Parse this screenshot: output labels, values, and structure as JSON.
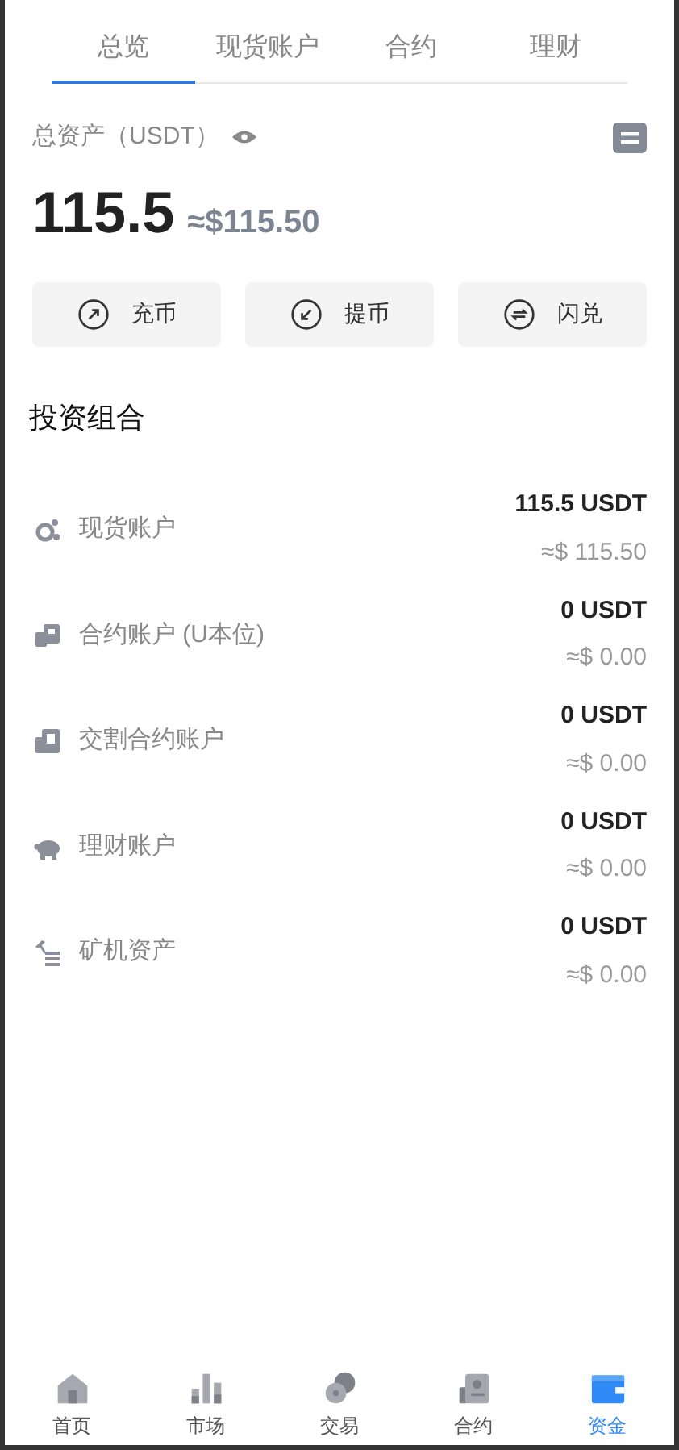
{
  "tabs": [
    {
      "label": "总览",
      "selected": true
    },
    {
      "label": "现货账户",
      "selected": false
    },
    {
      "label": "合约",
      "selected": false
    },
    {
      "label": "理财",
      "selected": false
    }
  ],
  "total": {
    "label": "总资产（USDT）",
    "amount": "115.5",
    "approx": "≈$115.50"
  },
  "actions": [
    {
      "kind": "deposit",
      "label": "充币"
    },
    {
      "kind": "withdraw",
      "label": "提币"
    },
    {
      "kind": "swap",
      "label": "闪兑"
    }
  ],
  "portfolio": {
    "title": "投资组合",
    "accounts": [
      {
        "kind": "spot",
        "name": "现货账户",
        "amount": "115.5 USDT",
        "approx": "≈$ 115.50"
      },
      {
        "kind": "futures",
        "name": "合约账户 (U本位)",
        "amount": "0 USDT",
        "approx": "≈$ 0.00"
      },
      {
        "kind": "delivery",
        "name": "交割合约账户",
        "amount": "0 USDT",
        "approx": "≈$ 0.00"
      },
      {
        "kind": "earn",
        "name": "理财账户",
        "amount": "0 USDT",
        "approx": "≈$ 0.00"
      },
      {
        "kind": "mining",
        "name": "矿机资产",
        "amount": "0 USDT",
        "approx": "≈$ 0.00"
      }
    ]
  },
  "nav": [
    {
      "kind": "home",
      "label": "首页",
      "selected": false
    },
    {
      "kind": "market",
      "label": "市场",
      "selected": false
    },
    {
      "kind": "trade",
      "label": "交易",
      "selected": false
    },
    {
      "kind": "contract",
      "label": "合约",
      "selected": false
    },
    {
      "kind": "funds",
      "label": "资金",
      "selected": true
    }
  ]
}
